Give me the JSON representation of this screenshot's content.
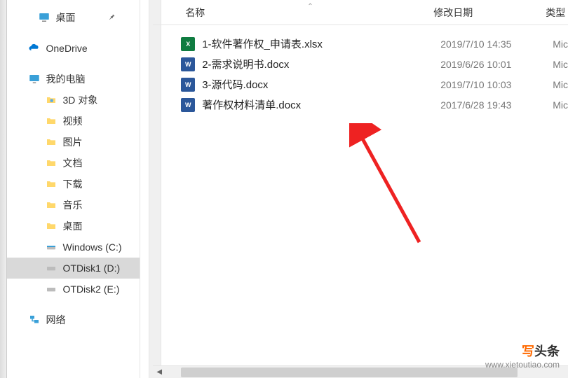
{
  "sidebar": {
    "pinned": {
      "label": "桌面"
    },
    "onedrive": {
      "label": "OneDrive"
    },
    "thispc": {
      "label": "我的电脑",
      "children": [
        {
          "label": "3D 对象"
        },
        {
          "label": "视频"
        },
        {
          "label": "图片"
        },
        {
          "label": "文档"
        },
        {
          "label": "下载"
        },
        {
          "label": "音乐"
        },
        {
          "label": "桌面"
        },
        {
          "label": "Windows (C:)"
        },
        {
          "label": "OTDisk1 (D:)"
        },
        {
          "label": "OTDisk2 (E:)"
        }
      ]
    },
    "network": {
      "label": "网络"
    }
  },
  "columns": {
    "name": "名称",
    "date": "修改日期",
    "type": "类型"
  },
  "files": [
    {
      "icon": "xlsx",
      "name": "1-软件著作权_申请表.xlsx",
      "date": "2019/7/10 14:35",
      "type": "Mic"
    },
    {
      "icon": "docx",
      "name": "2-需求说明书.docx",
      "date": "2019/6/26 10:01",
      "type": "Mic"
    },
    {
      "icon": "docx",
      "name": "3-源代码.docx",
      "date": "2019/7/10 10:03",
      "type": "Mic"
    },
    {
      "icon": "docx",
      "name": "著作权材料清单.docx",
      "date": "2017/6/28 19:43",
      "type": "Mic"
    }
  ],
  "watermark": {
    "brand1": "写",
    "brand2": "头条",
    "url": "www.xietoutiao.com"
  }
}
